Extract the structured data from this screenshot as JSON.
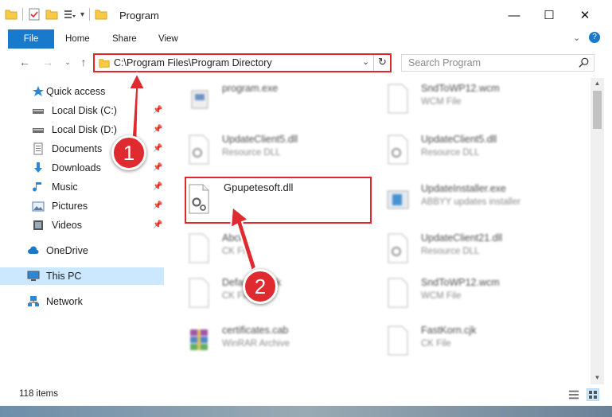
{
  "window": {
    "title": "Program",
    "controls": {
      "minimize": "—",
      "maximize": "☐",
      "close": "✕"
    }
  },
  "ribbon": {
    "tabs": [
      "File",
      "Home",
      "Share",
      "View"
    ]
  },
  "address": {
    "path": "C:\\Program Files\\Program Directory",
    "search_placeholder": "Search Program"
  },
  "nav": {
    "items": [
      {
        "label": "Quick access",
        "icon": "star-icon",
        "pinned": false
      },
      {
        "label": "Local Disk (C:)",
        "icon": "drive-icon",
        "pinned": true
      },
      {
        "label": "Local Disk (D:)",
        "icon": "drive-icon",
        "pinned": true
      },
      {
        "label": "Documents",
        "icon": "documents-icon",
        "pinned": true
      },
      {
        "label": "Downloads",
        "icon": "download-icon",
        "pinned": true
      },
      {
        "label": "Music",
        "icon": "music-icon",
        "pinned": true
      },
      {
        "label": "Pictures",
        "icon": "pictures-icon",
        "pinned": true
      },
      {
        "label": "Videos",
        "icon": "videos-icon",
        "pinned": true
      },
      {
        "label": "OneDrive",
        "icon": "cloud-icon",
        "pinned": false
      },
      {
        "label": "This PC",
        "icon": "computer-icon",
        "pinned": false,
        "selected": true
      },
      {
        "label": "Network",
        "icon": "network-icon",
        "pinned": false
      }
    ]
  },
  "files": [
    {
      "name": "program.exe",
      "type": ""
    },
    {
      "name": "SndToWP12.wcm",
      "type": "WCM File"
    },
    {
      "name": "UpdateClient5.dll",
      "type": "Resource DLL"
    },
    {
      "name": "UpdateClient5.dll",
      "type": "Resource DLL"
    },
    {
      "name": "Gpupetesoft.dll",
      "type": ""
    },
    {
      "name": "UpdateInstaller.exe",
      "type": "ABBYY updates installer"
    },
    {
      "name": "Abck",
      "type": "CK File"
    },
    {
      "name": "UpdateClient21.dll",
      "type": "Resource DLL"
    },
    {
      "name": "Default.Ct.cjk",
      "type": "CK File"
    },
    {
      "name": "SndToWP12.wcm",
      "type": "WCM File"
    },
    {
      "name": "certificates.cab",
      "type": "WinRAR Archive"
    },
    {
      "name": "FastKorn.cjk",
      "type": "CK File"
    }
  ],
  "status": {
    "item_count": "118 items"
  },
  "annotations": {
    "step1": "1",
    "step2": "2",
    "color": "#df2a2f"
  }
}
